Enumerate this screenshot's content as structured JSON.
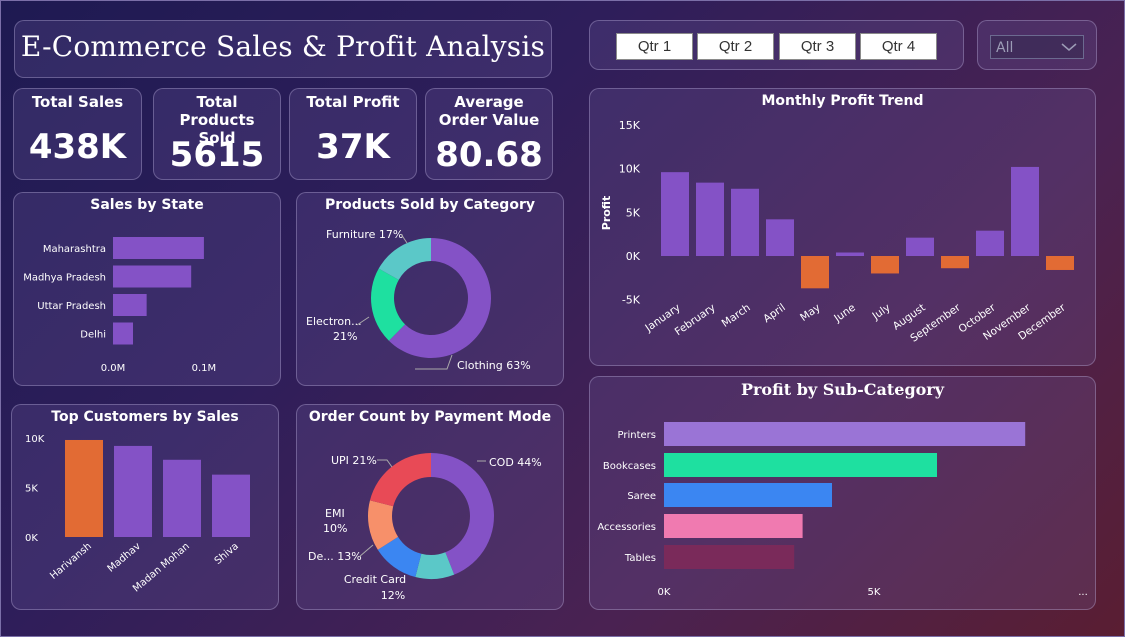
{
  "header": {
    "title": "E-Commerce Sales & Profit Analysis"
  },
  "filters": {
    "quarters": [
      "Qtr 1",
      "Qtr 2",
      "Qtr 3",
      "Qtr 4"
    ],
    "dropdown_value": "All"
  },
  "kpis": [
    {
      "label": "Total Sales",
      "value": "438K"
    },
    {
      "label": "Total Products Sold",
      "value": "5615"
    },
    {
      "label": "Total Profit",
      "value": "37K"
    },
    {
      "label": "Average Order Value",
      "value": "80.68"
    }
  ],
  "colors": {
    "purple": "#8452c6",
    "orange": "#e26b34",
    "teal": "#5bc8c8",
    "green": "#1ee0a0",
    "blue": "#3b86f2",
    "pink": "#f07ab0",
    "salmon": "#f7906a",
    "red": "#e84a56",
    "lavender": "#9a74d6",
    "plum": "#7a2a5a"
  },
  "chart_data": [
    {
      "id": "sales_by_state",
      "type": "bar",
      "orientation": "horizontal",
      "title": "Sales by State",
      "categories": [
        "Maharashtra",
        "Madhya Pradesh",
        "Uttar Pradesh",
        "Delhi"
      ],
      "values": [
        0.1,
        0.086,
        0.037,
        0.022
      ],
      "xticks": [
        "0.0M",
        "0.1M"
      ],
      "xlim": [
        0,
        0.11
      ],
      "unit": "M"
    },
    {
      "id": "products_by_category",
      "type": "pie",
      "variant": "donut",
      "title": "Products Sold by Category",
      "labels": [
        "Clothing",
        "Electronics",
        "Furniture"
      ],
      "display_labels": [
        "Clothing 63%",
        "Electron...",
        "Furniture 17%"
      ],
      "values": [
        63,
        21,
        17
      ],
      "extra_labels": [
        "21%"
      ]
    },
    {
      "id": "top_customers",
      "type": "bar",
      "title": "Top Customers by Sales",
      "categories": [
        "Harivansh",
        "Madhav",
        "Madan Mohan",
        "Shiva"
      ],
      "values": [
        9800,
        9200,
        7800,
        6300
      ],
      "yticks": [
        "10K",
        "5K",
        "0K"
      ],
      "ylim": [
        0,
        10000
      ],
      "highlight_index": 0
    },
    {
      "id": "payment_mode",
      "type": "pie",
      "variant": "donut",
      "title": "Order Count by Payment Mode",
      "labels": [
        "COD",
        "Debit Card",
        "Credit Card",
        "EMI",
        "UPI"
      ],
      "display_labels": [
        "COD 44%",
        "De... 13%",
        "Credit Card",
        "EMI",
        "UPI 21%"
      ],
      "values": [
        44,
        10,
        12,
        13,
        21
      ],
      "extra_labels": [
        "12%",
        "10%"
      ]
    },
    {
      "id": "monthly_profit",
      "type": "bar",
      "title": "Monthly Profit Trend",
      "ylabel": "Profit",
      "categories": [
        "January",
        "February",
        "March",
        "April",
        "May",
        "June",
        "July",
        "August",
        "September",
        "October",
        "November",
        "December"
      ],
      "values": [
        9600,
        8400,
        7700,
        4200,
        -3700,
        400,
        -2000,
        2100,
        -1400,
        2900,
        10200,
        -1600
      ],
      "yticks": [
        "15K",
        "10K",
        "5K",
        "0K",
        "-5K"
      ],
      "ylim": [
        -5000,
        15000
      ]
    },
    {
      "id": "profit_by_subcategory",
      "type": "bar",
      "orientation": "horizontal",
      "title": "Profit by Sub-Category",
      "categories": [
        "Printers",
        "Bookcases",
        "Saree",
        "Accessories",
        "Tables"
      ],
      "values": [
        8600,
        6500,
        4000,
        3300,
        3100
      ],
      "xticks": [
        "0K",
        "5K"
      ],
      "xlim": [
        0,
        10000
      ],
      "more_label": "..."
    }
  ]
}
